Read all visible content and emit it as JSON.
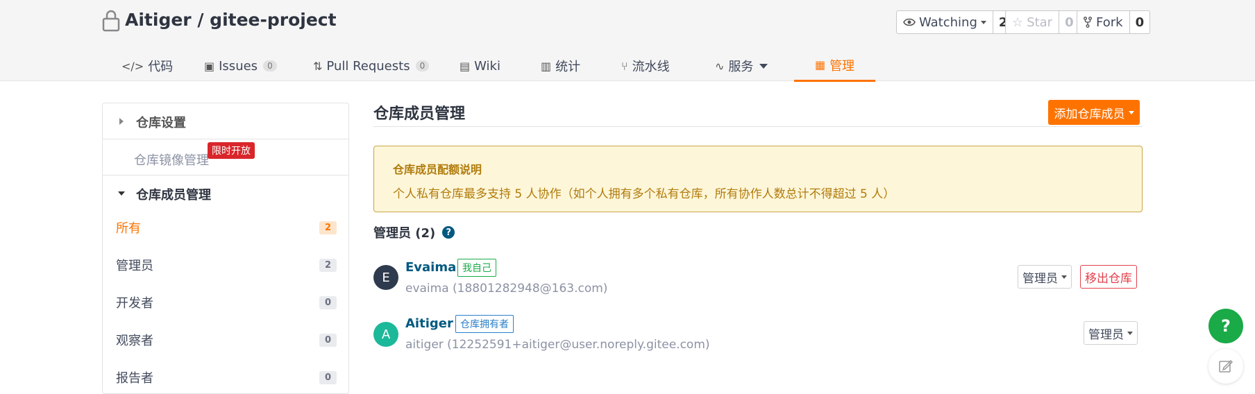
{
  "header": {
    "owner": "Aitiger",
    "separator": " / ",
    "repo": "gitee-project",
    "watch": {
      "label": "Watching",
      "count": "2"
    },
    "star": {
      "label": "Star",
      "count": "0"
    },
    "fork": {
      "label": "Fork",
      "count": "0"
    }
  },
  "tabs": [
    {
      "label": "代码",
      "icon": "code-icon"
    },
    {
      "label": "Issues",
      "icon": "issues-icon",
      "badge": "0"
    },
    {
      "label": "Pull Requests",
      "icon": "pull-request-icon",
      "badge": "0"
    },
    {
      "label": "Wiki",
      "icon": "wiki-icon"
    },
    {
      "label": "统计",
      "icon": "stats-icon"
    },
    {
      "label": "流水线",
      "icon": "pipeline-icon"
    },
    {
      "label": "服务",
      "icon": "pulse-icon"
    },
    {
      "label": "管理",
      "icon": "manage-icon",
      "active": true
    }
  ],
  "sidebar": {
    "settings": "仓库设置",
    "mirror": "仓库镜像管理",
    "mirror_badge": "限时开放",
    "members": "仓库成员管理",
    "items": [
      {
        "label": "所有",
        "count": "2",
        "active": true
      },
      {
        "label": "管理员",
        "count": "2"
      },
      {
        "label": "开发者",
        "count": "0"
      },
      {
        "label": "观察者",
        "count": "0"
      },
      {
        "label": "报告者",
        "count": "0"
      }
    ]
  },
  "main": {
    "title": "仓库成员管理",
    "add_button": "添加仓库成员",
    "notice_title": "仓库成员配额说明",
    "notice_text": "个人私有仓库最多支持 5 人协作（如个人拥有多个私有仓库，所有协作人数总计不得超过 5 人）",
    "section": "管理员 (2)",
    "members": [
      {
        "initial": "E",
        "name": "Evaima",
        "tag": "我自己",
        "email": "evaima (18801282948@163.com)",
        "role": "管理员",
        "remove": "移出仓库",
        "avatar_color": "#2e3a4d"
      },
      {
        "initial": "A",
        "name": "Aitiger",
        "tag": "仓库拥有者",
        "email": "aitiger (12252591+aitiger@user.noreply.gitee.com)",
        "role": "管理员",
        "avatar_color": "#1cb89a"
      }
    ]
  },
  "float": {
    "help": "?"
  },
  "colors": {
    "accent": "#fe7300",
    "link": "#005980",
    "danger": "#e3404b",
    "success": "#1aaa47"
  }
}
